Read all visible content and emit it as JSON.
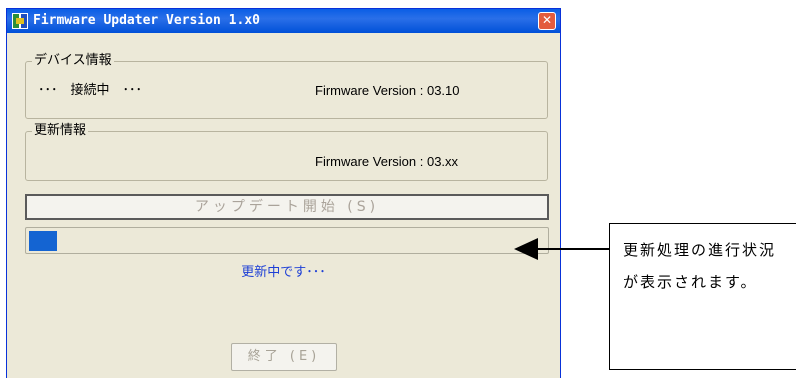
{
  "window": {
    "title": "Firmware Updater Version 1.x0",
    "close_icon": "close-icon",
    "app_icon": "firmware-updater-icon"
  },
  "device_info": {
    "title": "デバイス情報",
    "status": "･･･　接続中　･･･",
    "version": "Firmware Version : 03.10"
  },
  "update_info": {
    "title": "更新情報",
    "version": "Firmware Version : 03.xx"
  },
  "start_button": {
    "label": "アップデート開始 (S)"
  },
  "progress": {
    "value": 0.055,
    "color": "#1464d2"
  },
  "status_text": "更新中です･･･",
  "exit_button": {
    "label": "終了 (E)"
  },
  "annotation": {
    "text": "更新処理の進行状況が表示されます。"
  }
}
